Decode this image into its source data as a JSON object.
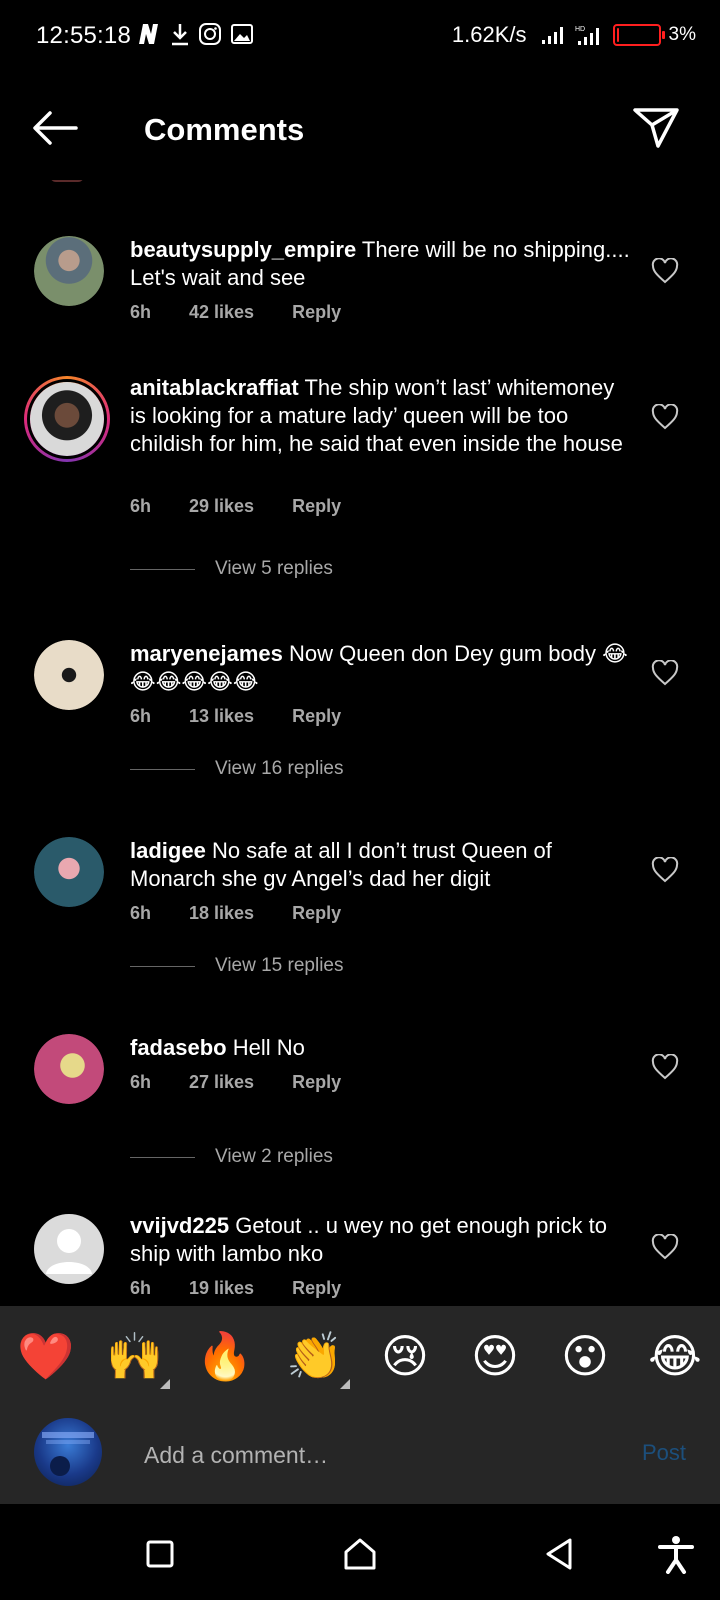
{
  "status_bar": {
    "time": "12:55:18",
    "network_speed": "1.62K/s",
    "battery_percent": "3%",
    "battery_level": 0.03,
    "icons": [
      "netflix-icon",
      "download-icon",
      "instagram-icon",
      "gallery-icon",
      "signal-icon",
      "hd-signal-icon",
      "battery-icon"
    ]
  },
  "header": {
    "title": "Comments",
    "back_icon": "back-arrow-icon",
    "share_icon": "send-icon"
  },
  "comments": [
    {
      "username": "beautysupply_empire",
      "text": "There will be no shipping.... Let's wait and see",
      "time": "6h",
      "likes": "42 likes",
      "reply": "Reply",
      "avatar_color": "#6d7d6a"
    },
    {
      "username": "anitablackraffiat",
      "text": "The ship won’t last’ whitemoney is looking for a mature lady’ queen will be too childish for him, he said that even inside the house",
      "time": "6h",
      "likes": "29 likes",
      "reply": "Reply",
      "view_replies": "View 5 replies",
      "avatar_color": "#4a4a4a"
    },
    {
      "username": "maryenejames",
      "text": "Now Queen don Dey gum body 😂😂😂😂😂😂",
      "time": "6h",
      "likes": "13 likes",
      "reply": "Reply",
      "view_replies": "View 16 replies",
      "avatar_color": "#d8c2a6"
    },
    {
      "username": "ladigee",
      "text": "No safe at all I don’t trust Queen of Monarch she gv Angel’s dad her digit",
      "time": "6h",
      "likes": "18 likes",
      "reply": "Reply",
      "view_replies": "View 15 replies",
      "avatar_color": "#3a6a7a"
    },
    {
      "username": "fadasebo",
      "text": "Hell No",
      "time": "6h",
      "likes": "27 likes",
      "reply": "Reply",
      "view_replies": "View 2 replies",
      "avatar_color": "#c86a8a"
    },
    {
      "username": "vvijvd225",
      "text": "Getout .. u wey no get enough prick to ship with lambo nko",
      "time": "6h",
      "likes": "19 likes",
      "reply": "Reply",
      "avatar_color": "#dbdbdb"
    }
  ],
  "reactions": [
    "❤️",
    "🙌",
    "🔥",
    "👏",
    "😢",
    "😍",
    "😮",
    "😂"
  ],
  "comment_input": {
    "placeholder": "Add a comment…",
    "post_label": "Post"
  },
  "navbar": {
    "icons": [
      "recents-icon",
      "home-icon",
      "back-icon",
      "accessibility-icon"
    ]
  },
  "colors": {
    "background": "#000000",
    "panel": "#262626",
    "meta_text": "#a8a8a8",
    "post_button": "#1c4f7c",
    "battery": "#ff1f1f"
  }
}
